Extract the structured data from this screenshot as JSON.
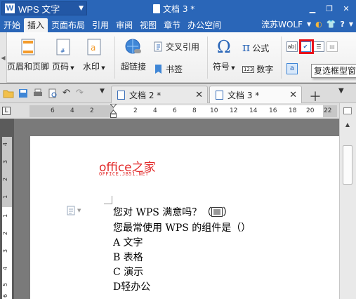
{
  "app": {
    "name": "WPS 文字",
    "document_title": "文档 3 *"
  },
  "menu": {
    "items": [
      "开始",
      "插入",
      "页面布局",
      "引用",
      "审阅",
      "视图",
      "章节",
      "办公空间"
    ],
    "active": "插入",
    "user": "流苏WOLF"
  },
  "ribbon": {
    "header_footer": "页眉和页脚",
    "page_number": "页码",
    "watermark": "水印",
    "hyperlink": "超链接",
    "cross_reference": "交叉引用",
    "bookmark": "书签",
    "symbol": "符号",
    "formula": "公式",
    "number": "数字",
    "number_icon_text": "123",
    "checkbox_tooltip": "复选框型窗"
  },
  "tabs": [
    {
      "label": "文档 2 *",
      "active": false
    },
    {
      "label": "文档 3 *",
      "active": true
    }
  ],
  "ruler": {
    "corner_symbol": "L",
    "horizontal": [
      "6",
      "4",
      "2",
      "2",
      "4",
      "6",
      "8",
      "10",
      "12",
      "14",
      "16",
      "18",
      "20",
      "22"
    ],
    "vertical": [
      "4",
      "3",
      "2",
      "1",
      "1",
      "2",
      "3",
      "4",
      "5",
      "6"
    ]
  },
  "document": {
    "logo_title": "office之家",
    "logo_subtitle": "OFFICE.JB51.NET",
    "question_1_prefix": "您对 WPS 满意吗？（",
    "question_1_suffix": "）",
    "question_2": "您最常使用 WPS 的组件是（）",
    "options": [
      "A 文字",
      "B 表格",
      "C 演示",
      "D轻办公"
    ]
  },
  "colors": {
    "titlebar": "#2a66b8",
    "highlight_box": "#e8121a",
    "logo_red": "#e22b2b"
  }
}
